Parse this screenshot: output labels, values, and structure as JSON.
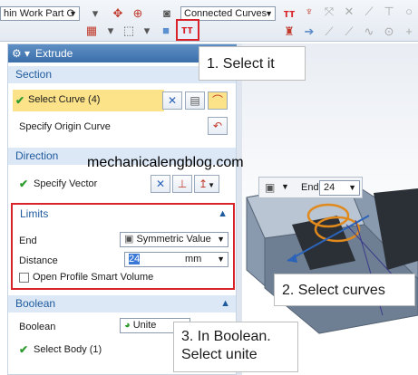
{
  "toolbar": {
    "part_filter": "hin Work Part O",
    "curve_rule": "Connected Curves"
  },
  "dialog": {
    "title": "Extrude",
    "section": {
      "header": "Section",
      "select_curve": "Select Curve (4)",
      "specify_origin": "Specify Origin Curve"
    },
    "direction": {
      "header": "Direction",
      "specify_vector": "Specify Vector"
    },
    "limits": {
      "header": "Limits",
      "end_label": "End",
      "end_value": "Symmetric Value",
      "distance_label": "Distance",
      "distance_value": "24",
      "distance_unit": "mm",
      "open_profile": "Open Profile Smart Volume"
    },
    "boolean": {
      "header": "Boolean",
      "boolean_label": "Boolean",
      "boolean_value": "Unite",
      "select_body": "Select Body (1)"
    }
  },
  "mini_toolbar": {
    "end_label": "End",
    "end_value": "24"
  },
  "callouts": {
    "select_it": "1. Select it",
    "select_curves": "2. Select curves",
    "boolean_line1": "3. In Boolean.",
    "boolean_line2": "Select unite"
  },
  "watermark": "mechanicalengblog.com",
  "colors": {
    "highlight_red": "#d9232a",
    "section_blue": "#1e5a9c",
    "title_blue": "#3b6fab",
    "selected_row": "#fce38a",
    "check_green": "#2e9b2e"
  }
}
